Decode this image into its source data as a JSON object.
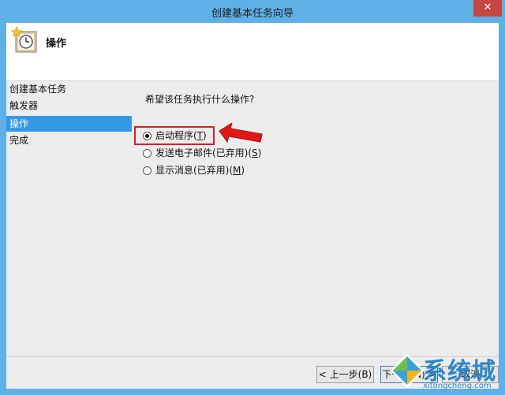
{
  "window": {
    "title": "创建基本任务向导",
    "close_glyph": "✕"
  },
  "header": {
    "title": "操作",
    "icon": "task-clock-icon"
  },
  "sidebar": {
    "items": [
      {
        "label": "创建基本任务",
        "active": false
      },
      {
        "label": "触发器",
        "active": false
      },
      {
        "label": "操作",
        "active": true
      },
      {
        "label": "完成",
        "active": false
      }
    ]
  },
  "main": {
    "question": "希望该任务执行什么操作?",
    "options": [
      {
        "label": "启动程序(",
        "key": "T",
        "tail": ")",
        "checked": true
      },
      {
        "label": "发送电子邮件(已弃用)(",
        "key": "S",
        "tail": ")",
        "checked": false
      },
      {
        "label": "显示消息(已弃用)(",
        "key": "M",
        "tail": ")",
        "checked": false
      }
    ]
  },
  "footer": {
    "back_label": "< 上一步(B)",
    "next_label": "下一步(N) >",
    "cancel_label": "取消"
  },
  "watermark": {
    "name": "系统城",
    "url": "xitongcheng.com"
  },
  "colors": {
    "titlebar": "#5fb0e6",
    "selection": "#3399e6",
    "annotation": "#d81f1f",
    "watermark": "#2f86c8"
  }
}
